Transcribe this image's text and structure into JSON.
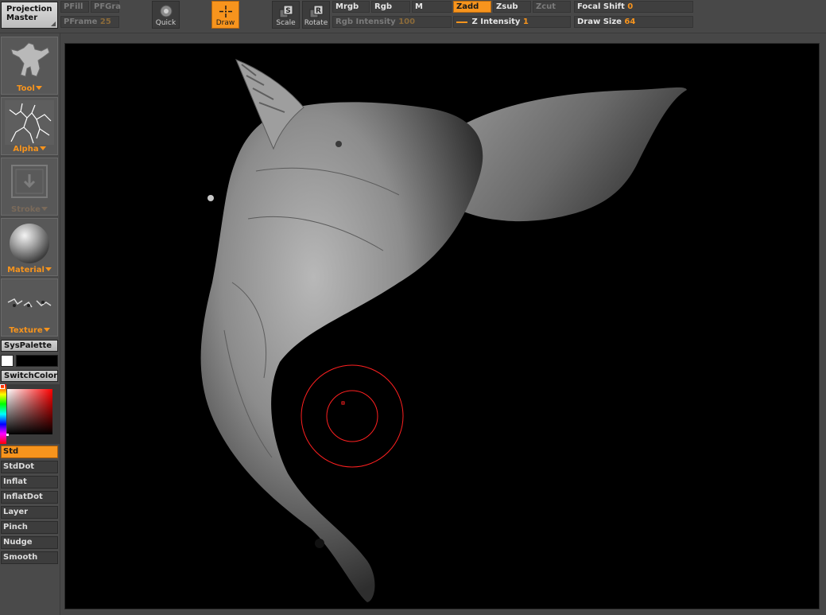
{
  "toolbar": {
    "projection_master": {
      "line1": "Projection",
      "line2": "Master"
    },
    "pfill": "PFill",
    "pfgra": "PFGra",
    "pframe": {
      "label": "PFrame",
      "value": "25"
    },
    "quick": "Quick",
    "draw": "Draw",
    "scale": "Scale",
    "rotate": "Rotate",
    "mrgb": "Mrgb",
    "rgb": "Rgb",
    "m": "M",
    "rgb_intensity": {
      "label": "Rgb Intensity",
      "value": "100"
    },
    "zadd": "Zadd",
    "zsub": "Zsub",
    "zcut": "Zcut",
    "z_intensity": {
      "label": "Z Intensity",
      "value": "1"
    },
    "focal_shift": {
      "label": "Focal Shift",
      "value": "0"
    },
    "draw_size": {
      "label": "Draw Size",
      "value": "64"
    }
  },
  "shelf": {
    "tool": "Tool",
    "alpha": "Alpha",
    "stroke": "Stroke",
    "material": "Material",
    "texture": "Texture",
    "syspalette": "SysPalette",
    "switchcolor": "SwitchColor"
  },
  "brushes": [
    {
      "label": "Std",
      "active": true
    },
    {
      "label": "StdDot",
      "active": false
    },
    {
      "label": "Inflat",
      "active": false
    },
    {
      "label": "InflatDot",
      "active": false
    },
    {
      "label": "Layer",
      "active": false
    },
    {
      "label": "Pinch",
      "active": false
    },
    {
      "label": "Nudge",
      "active": false
    },
    {
      "label": "Smooth",
      "active": false
    }
  ],
  "colors": {
    "accent": "#f7941d",
    "panel": "#484848",
    "canvas": "#000000",
    "cursor": "#ff2020",
    "main_color": "#ffffff",
    "secondary_color": "#000000"
  }
}
